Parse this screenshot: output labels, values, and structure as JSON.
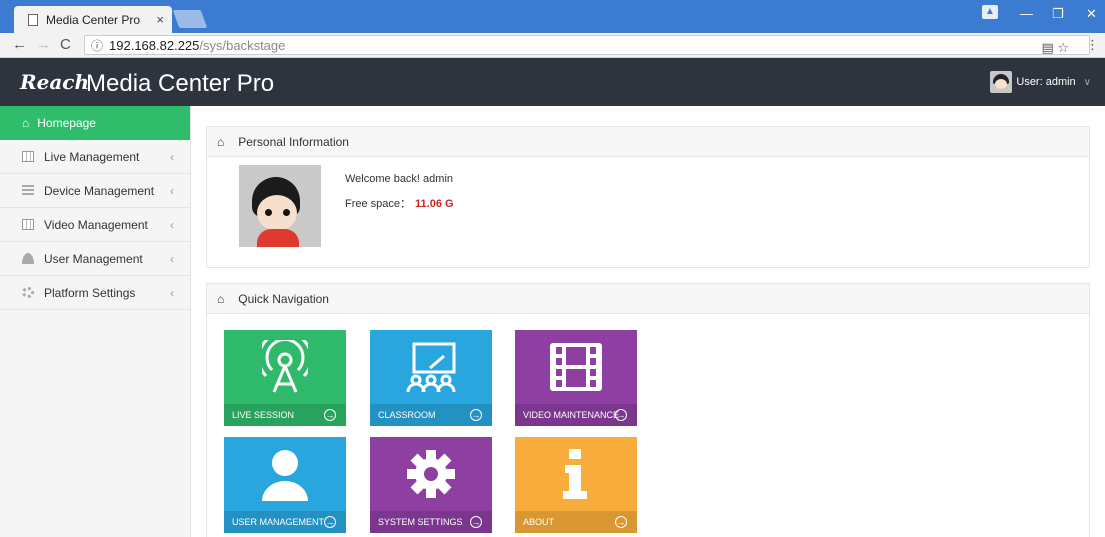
{
  "browser": {
    "tab_title": "Media Center Pro",
    "tab_close": "×",
    "url_host": "192.168.82.225",
    "url_path": "/sys/backstage",
    "info_icon": "ⓘ"
  },
  "header": {
    "logo_text": "Reach",
    "app_title": "Media Center Pro",
    "user_label": "User: admin"
  },
  "sidebar": {
    "items": [
      {
        "label": "Homepage",
        "icon": "home-icon"
      },
      {
        "label": "Live Management",
        "icon": "film-icon"
      },
      {
        "label": "Device Management",
        "icon": "device-icon"
      },
      {
        "label": "Video Management",
        "icon": "film-icon"
      },
      {
        "label": "User Management",
        "icon": "user-icon"
      },
      {
        "label": "Platform Settings",
        "icon": "gear-icon"
      }
    ]
  },
  "personal": {
    "title": "Personal Information",
    "welcome": "Welcome back! admin",
    "free_label": "Free space：",
    "free_value": "11.06 G"
  },
  "quicknav": {
    "title": "Quick Navigation",
    "tiles": [
      {
        "label": "LIVE SESSION",
        "color": "#2fb96b",
        "icon": "broadcast-icon"
      },
      {
        "label": "CLASSROOM",
        "color": "#2aa6df",
        "icon": "classroom-icon"
      },
      {
        "label": "VIDEO MAINTENANCE",
        "color": "#8d3fa2",
        "icon": "film-icon"
      },
      {
        "label": "USER MANAGEMENT",
        "color": "#2aa6df",
        "icon": "user-icon"
      },
      {
        "label": "SYSTEM SETTINGS",
        "color": "#8d3fa2",
        "icon": "gear-icon"
      },
      {
        "label": "ABOUT",
        "color": "#f7ac3b",
        "icon": "info-icon"
      }
    ]
  }
}
